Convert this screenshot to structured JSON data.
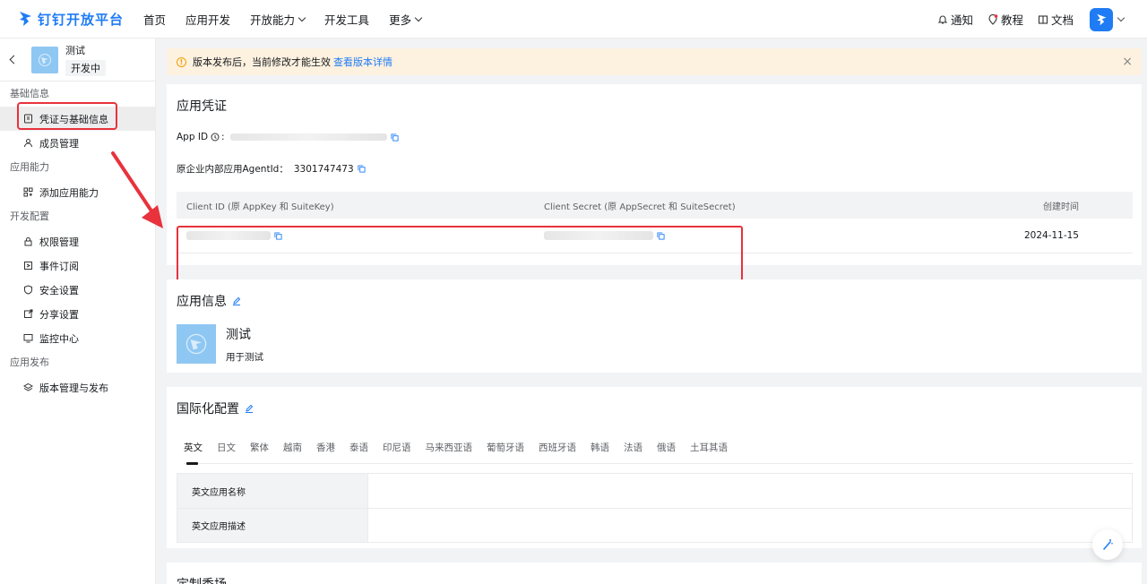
{
  "brand": {
    "name": "钉钉开放平台",
    "accent": "#1f7cf5",
    "highlight": "#e8323c"
  },
  "nav": {
    "items": [
      "首页",
      "应用开发",
      "开放能力",
      "开发工具",
      "更多"
    ],
    "right": {
      "notify": "通知",
      "tutorial": "教程",
      "docs": "文档"
    }
  },
  "sidebar": {
    "app_name": "测试",
    "app_status": "开发中",
    "groups": [
      {
        "title": "基础信息",
        "items": [
          "凭证与基础信息",
          "成员管理"
        ]
      },
      {
        "title": "应用能力",
        "items": [
          "添加应用能力"
        ]
      },
      {
        "title": "开发配置",
        "items": [
          "权限管理",
          "事件订阅",
          "安全设置",
          "分享设置",
          "监控中心"
        ]
      },
      {
        "title": "应用发布",
        "items": [
          "版本管理与发布"
        ]
      }
    ]
  },
  "notice": {
    "text": "版本发布后，当前修改才能生效",
    "link": "查看版本详情"
  },
  "credentials": {
    "title": "应用凭证",
    "app_id_label": "App ID",
    "agent_label": "原企业内部应用AgentId：",
    "agent_value": "3301747473",
    "columns": [
      "Client ID (原 AppKey 和 SuiteKey)",
      "Client Secret (原 AppSecret 和 SuiteSecret)",
      "创建时间"
    ],
    "created": "2024-11-15"
  },
  "app_info": {
    "title": "应用信息",
    "name": "测试",
    "desc": "用于测试"
  },
  "i18n": {
    "title": "国际化配置",
    "tabs": [
      "英文",
      "日文",
      "繁体",
      "越南",
      "香港",
      "泰语",
      "印尼语",
      "马来西亚语",
      "葡萄牙语",
      "西班牙语",
      "韩语",
      "法语",
      "俄语",
      "土耳其语"
    ],
    "rows": [
      "英文应用名称",
      "英文应用描述"
    ]
  },
  "next_card_title": "定制秀场"
}
